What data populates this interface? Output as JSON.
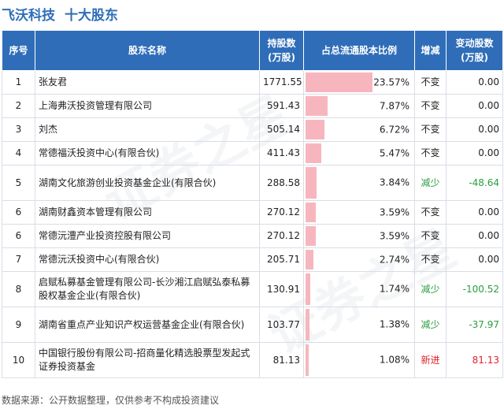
{
  "header": {
    "company": "飞沃科技",
    "title": "十大股东"
  },
  "colors": {
    "header_bg": "#2f6db8",
    "bar": "#f7b6bd",
    "increase": "#e0222c",
    "decrease": "#2a9d3e"
  },
  "table": {
    "columns": [
      "序号",
      "股东名称",
      "持股数\n(万股)",
      "占总流通股本比例",
      "增减",
      "变动股数\n(万股)"
    ],
    "rows": [
      {
        "rank": "1",
        "name": "张友君",
        "shares": "1771.55",
        "ratio": 23.57,
        "ratio_text": "23.57%",
        "change": "不变",
        "delta": "0.00",
        "dir": "none"
      },
      {
        "rank": "2",
        "name": "上海弗沃投资管理有限公司",
        "shares": "591.43",
        "ratio": 7.87,
        "ratio_text": "7.87%",
        "change": "不变",
        "delta": "0.00",
        "dir": "none"
      },
      {
        "rank": "3",
        "name": "刘杰",
        "shares": "505.14",
        "ratio": 6.72,
        "ratio_text": "6.72%",
        "change": "不变",
        "delta": "0.00",
        "dir": "none"
      },
      {
        "rank": "4",
        "name": "常德福沃投资中心(有限合伙)",
        "shares": "411.43",
        "ratio": 5.47,
        "ratio_text": "5.47%",
        "change": "不变",
        "delta": "0.00",
        "dir": "none"
      },
      {
        "rank": "5",
        "name": "湖南文化旅游创业投资基金企业(有限合伙)",
        "shares": "288.58",
        "ratio": 3.84,
        "ratio_text": "3.84%",
        "change": "减少",
        "delta": "-48.64",
        "dir": "down"
      },
      {
        "rank": "6",
        "name": "湖南财鑫资本管理有限公司",
        "shares": "270.12",
        "ratio": 3.59,
        "ratio_text": "3.59%",
        "change": "不变",
        "delta": "0.00",
        "dir": "none"
      },
      {
        "rank": "6",
        "name": "常德沅澧产业投资控股有限公司",
        "shares": "270.12",
        "ratio": 3.59,
        "ratio_text": "3.59%",
        "change": "不变",
        "delta": "0.00",
        "dir": "none"
      },
      {
        "rank": "7",
        "name": "常德沅沃投资中心(有限合伙)",
        "shares": "205.71",
        "ratio": 2.74,
        "ratio_text": "2.74%",
        "change": "不变",
        "delta": "0.00",
        "dir": "none"
      },
      {
        "rank": "8",
        "name": "启赋私募基金管理有限公司-长沙湘江启赋弘泰私募股权基金企业(有限合伙)",
        "shares": "130.91",
        "ratio": 1.74,
        "ratio_text": "1.74%",
        "change": "减少",
        "delta": "-100.52",
        "dir": "down"
      },
      {
        "rank": "9",
        "name": "湖南省重点产业知识产权运营基金企业(有限合伙)",
        "shares": "103.77",
        "ratio": 1.38,
        "ratio_text": "1.38%",
        "change": "减少",
        "delta": "-37.97",
        "dir": "down"
      },
      {
        "rank": "10",
        "name": "中国银行股份有限公司-招商量化精选股票型发起式证券投资基金",
        "shares": "81.13",
        "ratio": 1.08,
        "ratio_text": "1.08%",
        "change": "新进",
        "delta": "81.13",
        "dir": "up"
      }
    ]
  },
  "footer": "数据来源：公开数据整理，仅供参考不构成投资建议",
  "watermark": "证券之星"
}
